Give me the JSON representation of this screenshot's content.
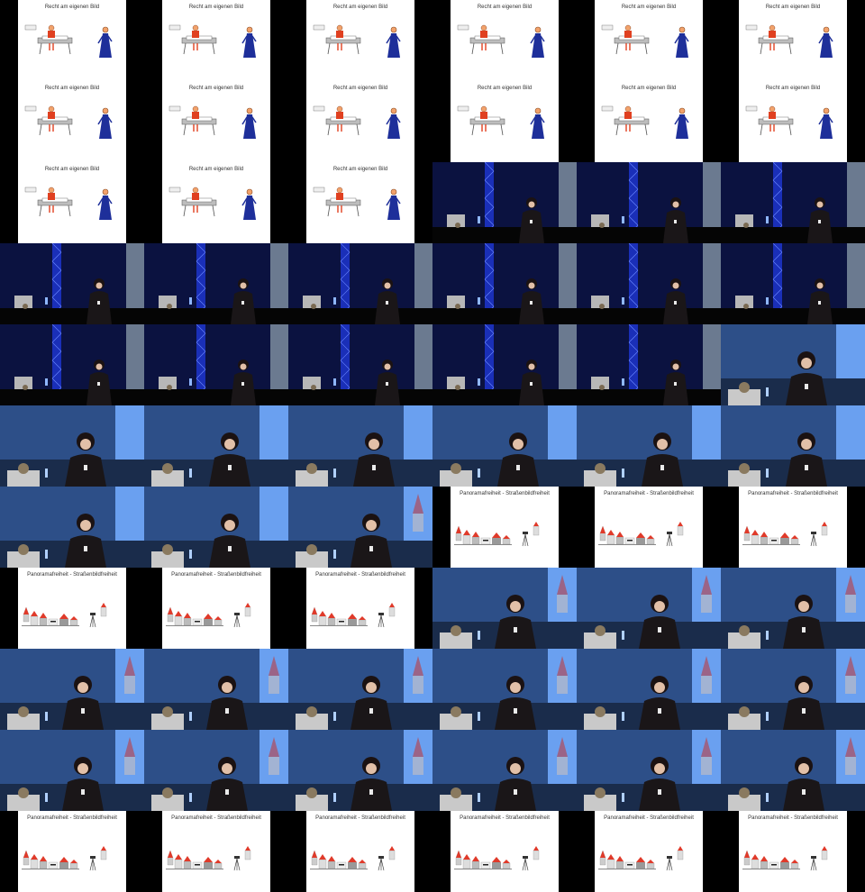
{
  "titles": {
    "recht": "Recht am eigenen Bild",
    "panorama": "Panoramafreiheit - Straßenbildfreiheit"
  },
  "rows": [
    [
      "recht",
      "recht",
      "recht",
      "recht",
      "recht",
      "recht"
    ],
    [
      "recht",
      "recht",
      "recht",
      "recht",
      "recht",
      "recht"
    ],
    [
      "recht",
      "recht",
      "recht",
      "stage",
      "stage",
      "stage"
    ],
    [
      "stage",
      "stage",
      "stage",
      "stage",
      "stage",
      "stage"
    ],
    [
      "stage",
      "stage",
      "stage",
      "stage",
      "stage",
      "close"
    ],
    [
      "close",
      "close",
      "close",
      "close",
      "close",
      "close"
    ],
    [
      "close",
      "close",
      "close-house",
      "panorama",
      "panorama",
      "panorama"
    ],
    [
      "panorama",
      "panorama",
      "panorama",
      "closeh",
      "closeh",
      "closeh"
    ],
    [
      "closeh",
      "closeh",
      "closeh",
      "closeh",
      "closeh",
      "closeh"
    ],
    [
      "closeh",
      "closeh",
      "closeh",
      "closeh",
      "closeh",
      "closeh"
    ],
    [
      "panorama",
      "panorama",
      "panorama",
      "panorama",
      "panorama",
      "panorama"
    ]
  ],
  "colors": {
    "stage_blue": "#1a2fb8",
    "slide_blue": "#6aa0f0",
    "roof_red": "#e03a2a",
    "figure_blue": "#1e2f9a",
    "figure_red": "#e04020"
  }
}
